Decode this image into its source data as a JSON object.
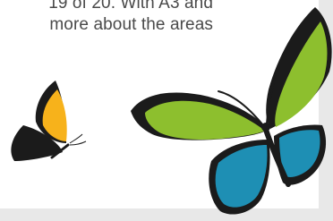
{
  "text": {
    "line1": "19 of 20. With A3 and",
    "line2": "more about the areas"
  },
  "colors": {
    "background": "#ffffff",
    "frame": "#e8e8e8",
    "text": "#4a4a4a",
    "black": "#1b1b1b",
    "yellow": "#f7b21b",
    "green": "#8dbf2e",
    "blue": "#1e8fb4"
  },
  "icons": {
    "small_butterfly": "butterfly-illustration",
    "large_butterfly": "butterfly-illustration"
  }
}
